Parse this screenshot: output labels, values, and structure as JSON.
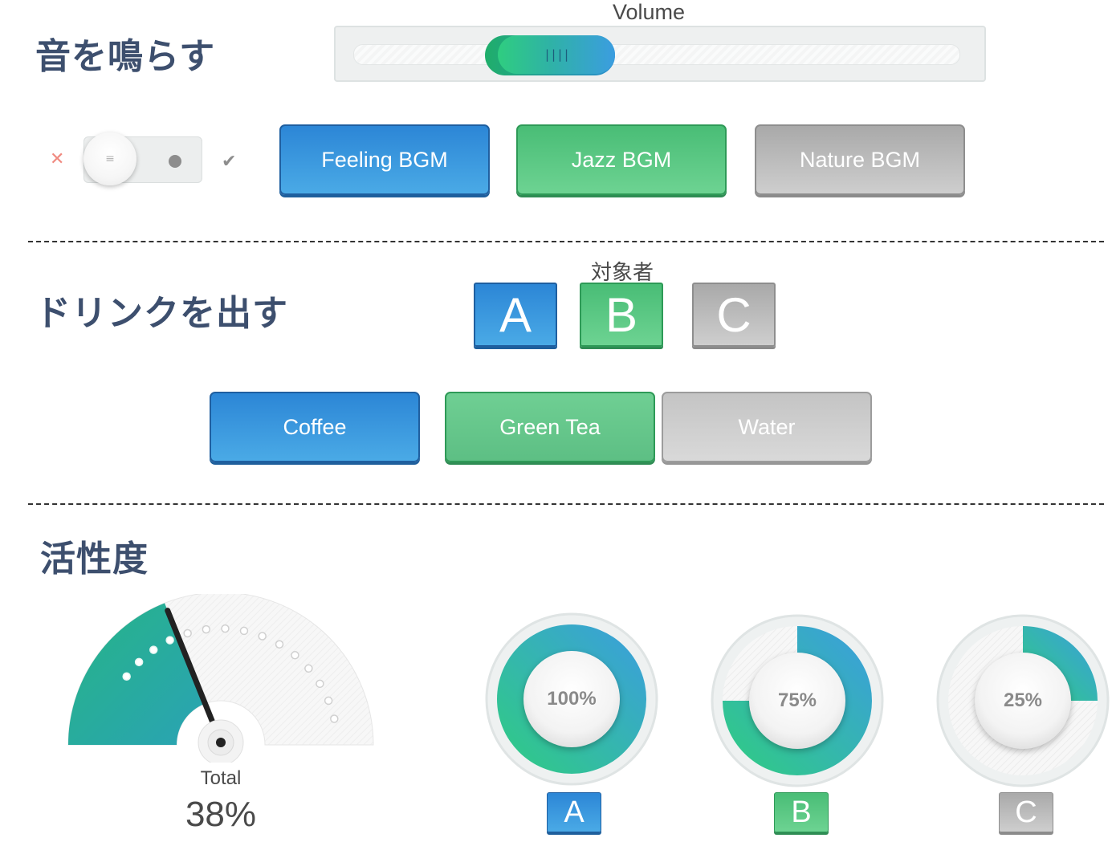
{
  "sound": {
    "title": "音を鳴らす",
    "volume": {
      "label": "Volume",
      "level_percent": 30
    },
    "toggle": {
      "state": "off",
      "off_icon": "close-icon",
      "on_icon": "check-icon"
    },
    "buttons": [
      {
        "label": "Feeling BGM",
        "color": "#2c86d6"
      },
      {
        "label": "Jazz BGM",
        "color": "#49bd76"
      },
      {
        "label": "Nature BGM",
        "color": "#a9a9a9"
      }
    ]
  },
  "drink": {
    "title": "ドリンクを出す",
    "target_label": "対象者",
    "targets": [
      "A",
      "B",
      "C"
    ],
    "buttons": [
      {
        "label": "Coffee",
        "color": "#2c86d6"
      },
      {
        "label": "Green Tea",
        "color": "#49bd76"
      },
      {
        "label": "Water",
        "color": "#c4c4c4"
      }
    ]
  },
  "activity": {
    "title": "活性度",
    "total": {
      "label": "Total",
      "value": "38%",
      "fraction": 0.38
    },
    "people": [
      {
        "name": "A",
        "value": "100%",
        "fraction": 1.0,
        "badge_color": "#2c86d6"
      },
      {
        "name": "B",
        "value": "75%",
        "fraction": 0.75,
        "badge_color": "#49bd76"
      },
      {
        "name": "C",
        "value": "25%",
        "fraction": 0.25,
        "badge_color": "#a9a9a9"
      }
    ]
  },
  "colors": {
    "title": "#3d4f6e",
    "accent_green": "#2fcd80",
    "accent_blue": "#3b9de0",
    "gauge_teal": "#1fa79a"
  }
}
